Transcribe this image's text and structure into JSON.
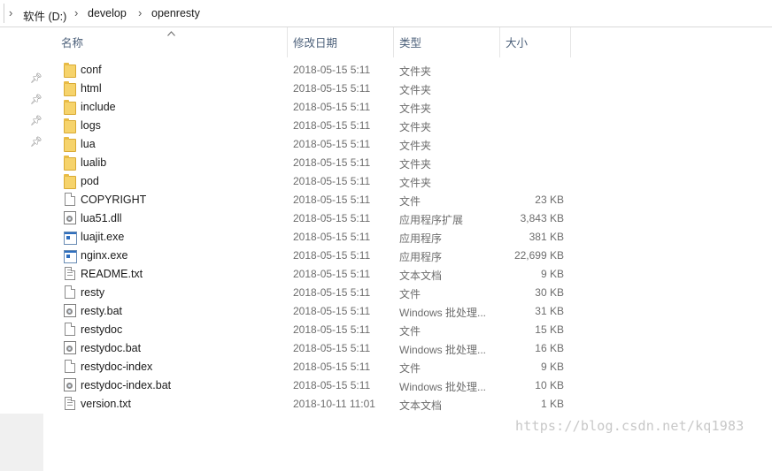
{
  "breadcrumb": {
    "sep": "›",
    "items": [
      "软件 (D:)",
      "develop",
      "openresty"
    ]
  },
  "columns": {
    "name": "名称",
    "date": "修改日期",
    "type": "类型",
    "size": "大小",
    "sort_icon": "chevron-up-icon"
  },
  "quick_access_pins": 4,
  "files": [
    {
      "icon": "folder-icon",
      "name": "conf",
      "date": "2018-05-15 5:11",
      "type": "文件夹",
      "size": ""
    },
    {
      "icon": "folder-icon",
      "name": "html",
      "date": "2018-05-15 5:11",
      "type": "文件夹",
      "size": ""
    },
    {
      "icon": "folder-icon",
      "name": "include",
      "date": "2018-05-15 5:11",
      "type": "文件夹",
      "size": ""
    },
    {
      "icon": "folder-icon",
      "name": "logs",
      "date": "2018-05-15 5:11",
      "type": "文件夹",
      "size": ""
    },
    {
      "icon": "folder-icon",
      "name": "lua",
      "date": "2018-05-15 5:11",
      "type": "文件夹",
      "size": ""
    },
    {
      "icon": "folder-icon",
      "name": "lualib",
      "date": "2018-05-15 5:11",
      "type": "文件夹",
      "size": ""
    },
    {
      "icon": "folder-icon",
      "name": "pod",
      "date": "2018-05-15 5:11",
      "type": "文件夹",
      "size": ""
    },
    {
      "icon": "file-icon",
      "name": "COPYRIGHT",
      "date": "2018-05-15 5:11",
      "type": "文件",
      "size": "23 KB"
    },
    {
      "icon": "dll-icon",
      "name": "lua51.dll",
      "date": "2018-05-15 5:11",
      "type": "应用程序扩展",
      "size": "3,843 KB"
    },
    {
      "icon": "exe-icon",
      "name": "luajit.exe",
      "date": "2018-05-15 5:11",
      "type": "应用程序",
      "size": "381 KB"
    },
    {
      "icon": "exe-icon",
      "name": "nginx.exe",
      "date": "2018-05-15 5:11",
      "type": "应用程序",
      "size": "22,699 KB"
    },
    {
      "icon": "text-file-icon",
      "name": "README.txt",
      "date": "2018-05-15 5:11",
      "type": "文本文档",
      "size": "9 KB"
    },
    {
      "icon": "file-icon",
      "name": "resty",
      "date": "2018-05-15 5:11",
      "type": "文件",
      "size": "30 KB"
    },
    {
      "icon": "batch-file-icon",
      "name": "resty.bat",
      "date": "2018-05-15 5:11",
      "type": "Windows 批处理...",
      "size": "31 KB"
    },
    {
      "icon": "file-icon",
      "name": "restydoc",
      "date": "2018-05-15 5:11",
      "type": "文件",
      "size": "15 KB"
    },
    {
      "icon": "batch-file-icon",
      "name": "restydoc.bat",
      "date": "2018-05-15 5:11",
      "type": "Windows 批处理...",
      "size": "16 KB"
    },
    {
      "icon": "file-icon",
      "name": "restydoc-index",
      "date": "2018-05-15 5:11",
      "type": "文件",
      "size": "9 KB"
    },
    {
      "icon": "batch-file-icon",
      "name": "restydoc-index.bat",
      "date": "2018-05-15 5:11",
      "type": "Windows 批处理...",
      "size": "10 KB"
    },
    {
      "icon": "text-file-icon",
      "name": "version.txt",
      "date": "2018-10-11 11:01",
      "type": "文本文档",
      "size": "1 KB"
    }
  ],
  "watermark": "https://blog.csdn.net/kq1983"
}
